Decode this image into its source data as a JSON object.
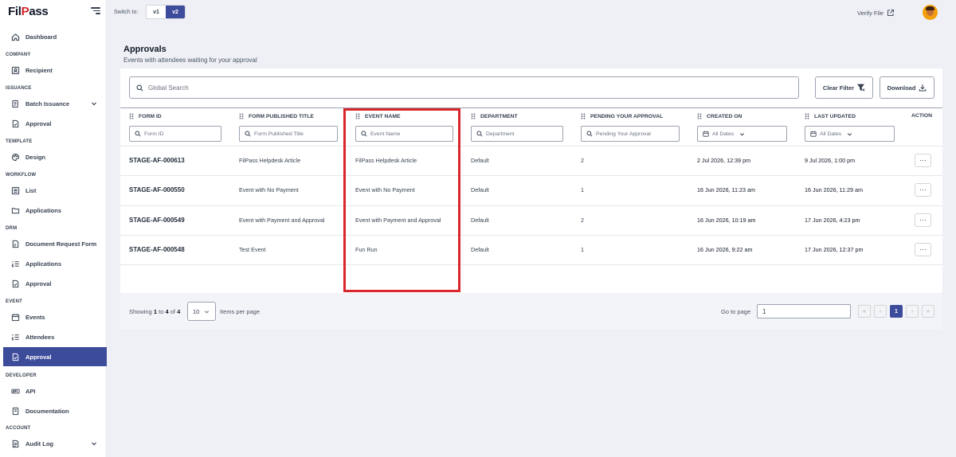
{
  "brand": {
    "logo_text": "FilPass"
  },
  "topbar": {
    "switch_label": "Switch to:",
    "versions": [
      "v1",
      "v2"
    ],
    "selected_version": "v2",
    "verify_label": "Verify File"
  },
  "sidebar": {
    "dashboard": "Dashboard",
    "sections": {
      "company": "COMPANY",
      "issuance": "ISSUANCE",
      "template": "TEMPLATE",
      "workflow": "WORKFLOW",
      "drm": "DRM",
      "event": "EVENT",
      "developer": "DEVELOPER",
      "account": "ACCOUNT"
    },
    "items": {
      "recipient": "Recipient",
      "batch_issuance": "Batch Issuance",
      "issuance_approval": "Approval",
      "design": "Design",
      "list": "List",
      "workflow_applications": "Applications",
      "document_request_form": "Document Request Form",
      "drm_applications": "Applications",
      "drm_approval": "Approval",
      "events": "Events",
      "attendees": "Attendees",
      "event_approval": "Approval",
      "api": "API",
      "documentation": "Documentation",
      "audit_log": "Audit Log"
    },
    "active_item": "event_approval"
  },
  "page": {
    "title": "Approvals",
    "subtitle": "Events with attendees waiting for your approval"
  },
  "toolbar": {
    "search_placeholder": "Global Search",
    "clear_filter_label": "Clear Filter",
    "download_label": "Download"
  },
  "table": {
    "headers": {
      "form_id": "FORM ID",
      "form_title": "FORM PUBLISHED TITLE",
      "event_name": "EVENT NAME",
      "department": "DEPARTMENT",
      "pending": "PENDING YOUR APPROVAL",
      "created_on": "CREATED ON",
      "last_updated": "LAST UPDATED",
      "action": "ACTION"
    },
    "filters": {
      "form_id": "Form ID",
      "form_title": "Form Published Title",
      "event_name": "Event Name",
      "department": "Department",
      "pending": "Pending Your Approval",
      "created_on": "All Dates",
      "last_updated": "All Dates"
    },
    "rows": [
      {
        "form_id": "STAGE-AF-000613",
        "form_title": "FilPass Helpdesk Article",
        "event_name": "FilPass Helpdesk Article",
        "department": "Default",
        "pending": "2",
        "created_on": "2 Jul 2026, 12:39 pm",
        "last_updated": "9 Jul 2026, 1:00 pm",
        "action": "···"
      },
      {
        "form_id": "STAGE-AF-000550",
        "form_title": "Event with No Payment",
        "event_name": "Event with No Payment",
        "department": "Default",
        "pending": "1",
        "created_on": "16 Jun 2026, 11:23 am",
        "last_updated": "16 Jun 2026, 11:29 am",
        "action": "···"
      },
      {
        "form_id": "STAGE-AF-000549",
        "form_title": "Event with Payment and Approval",
        "event_name": "Event with Payment and Approval",
        "department": "Default",
        "pending": "2",
        "created_on": "16 Jun 2026, 10:19 am",
        "last_updated": "17 Jun 2026, 4:23 pm",
        "action": "···"
      },
      {
        "form_id": "STAGE-AF-000548",
        "form_title": "Test Event",
        "event_name": "Fun Run",
        "department": "Default",
        "pending": "1",
        "created_on": "16 Jun 2026, 9:22 am",
        "last_updated": "17 Jun 2026, 12:37 pm",
        "action": "···"
      }
    ]
  },
  "pagination": {
    "showing_prefix": "Showing",
    "range_start": "1",
    "to_word": "to",
    "range_end": "4",
    "of_word": "of",
    "total": "4",
    "per_page_value": "10",
    "per_page_label": "Items per page",
    "goto_label": "Go to page",
    "goto_value": "1",
    "first": "«",
    "prev": "‹",
    "current_page": "1",
    "next": "›",
    "last": "»"
  },
  "colors": {
    "primary": "#3d4b9b",
    "highlight": "#d9262d",
    "logo_accent": "#d32027"
  }
}
